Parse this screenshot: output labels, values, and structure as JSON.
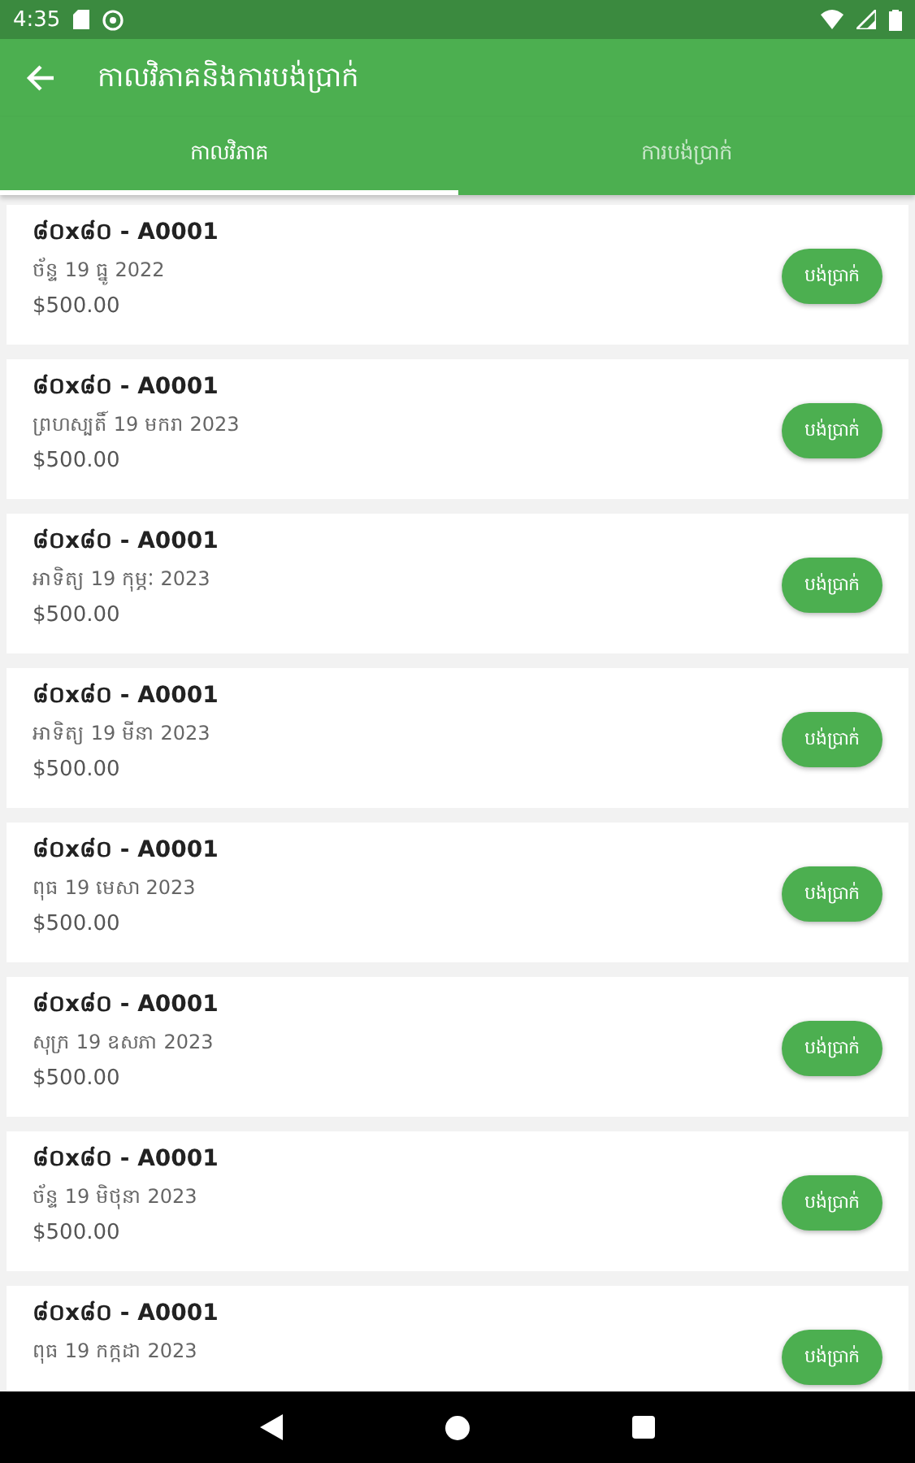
{
  "status_bar": {
    "time": "4:35"
  },
  "app_bar": {
    "title": "កាលវិភាគនិងការបង់ប្រាក់"
  },
  "tabs": [
    {
      "label": "កាលវិភាគ",
      "selected": true
    },
    {
      "label": "ការបង់ប្រាក់",
      "selected": false
    }
  ],
  "items": [
    {
      "title": "៨០x៨០ - A0001",
      "date": "ច័ន្ទ 19 ធ្នូ 2022",
      "amount": "$500.00",
      "button": "បង់ប្រាក់"
    },
    {
      "title": "៨០x៨០ - A0001",
      "date": "ព្រហស្បតិ៍ 19 មករា 2023",
      "amount": "$500.00",
      "button": "បង់ប្រាក់"
    },
    {
      "title": "៨០x៨០ - A0001",
      "date": "អាទិត្យ 19 កុម្ភៈ 2023",
      "amount": "$500.00",
      "button": "បង់ប្រាក់"
    },
    {
      "title": "៨០x៨០ - A0001",
      "date": "អាទិត្យ 19 មីនា 2023",
      "amount": "$500.00",
      "button": "បង់ប្រាក់"
    },
    {
      "title": "៨០x៨០ - A0001",
      "date": "ពុធ 19 មេសា 2023",
      "amount": "$500.00",
      "button": "បង់ប្រាក់"
    },
    {
      "title": "៨០x៨០ - A0001",
      "date": "សុក្រ 19 ឧសភា 2023",
      "amount": "$500.00",
      "button": "បង់ប្រាក់"
    },
    {
      "title": "៨០x៨០ - A0001",
      "date": "ច័ន្ទ 19 មិថុនា 2023",
      "amount": "$500.00",
      "button": "បង់ប្រាក់"
    },
    {
      "title": "៨០x៨០ - A0001",
      "date": "ពុធ 19 កក្កដា 2023",
      "button": "បង់ប្រាក់"
    }
  ]
}
